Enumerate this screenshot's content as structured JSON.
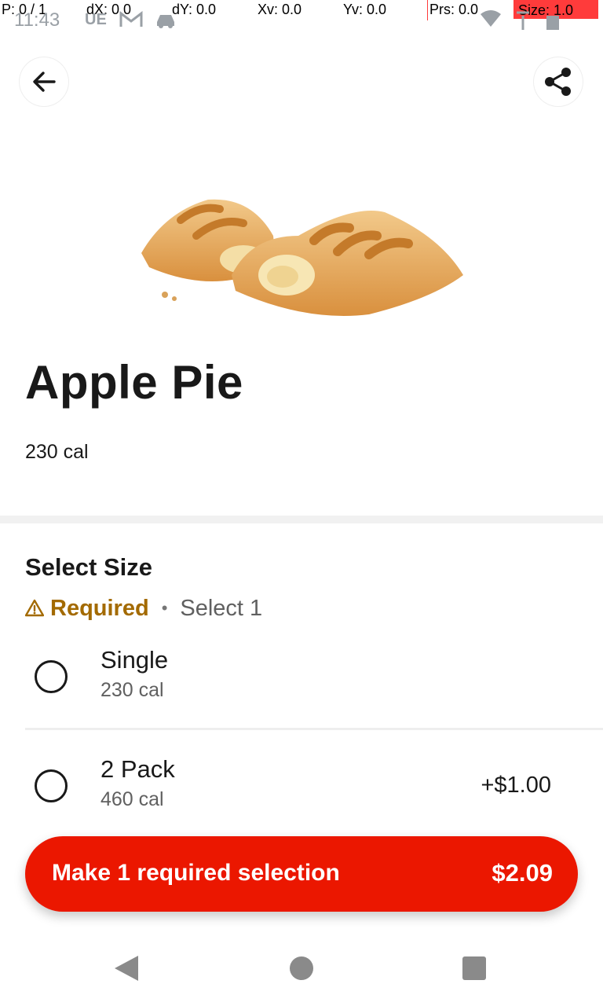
{
  "debug": {
    "pointer": "P: 0 / 1",
    "dx": "dX: 0.0",
    "dy": "dY: 0.0",
    "xv": "Xv: 0.0",
    "yv": "Yv: 0.0",
    "prs": "Prs: 0.0",
    "size": "Size: 1.0"
  },
  "status_bar": {
    "time": "11:43",
    "icons": [
      "ue-icon",
      "gmail-icon",
      "car-icon",
      "wifi-icon",
      "signal-icon",
      "battery-icon"
    ]
  },
  "header": {
    "back_icon": "arrow-left-icon",
    "share_icon": "share-icon"
  },
  "product": {
    "name": "Apple Pie",
    "calories": "230 cal"
  },
  "size_section": {
    "title": "Select Size",
    "required_label": "Required",
    "separator": "•",
    "select_hint": "Select 1",
    "options": [
      {
        "name": "Single",
        "calories": "230 cal",
        "price": ""
      },
      {
        "name": "2 Pack",
        "calories": "460 cal",
        "price": "+$1.00"
      }
    ]
  },
  "cta": {
    "label": "Make 1 required selection",
    "price": "$2.09",
    "color": "#eb1700"
  },
  "nav": {
    "back": "nav-back-icon",
    "home": "nav-home-icon",
    "recents": "nav-recents-icon"
  }
}
